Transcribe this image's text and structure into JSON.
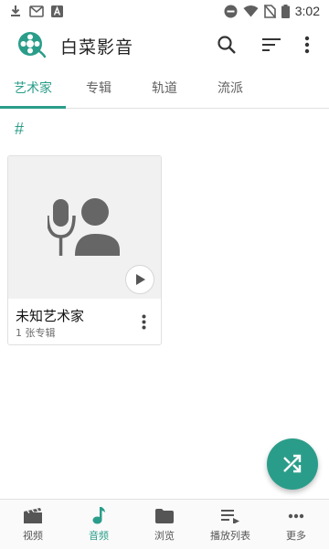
{
  "status_bar": {
    "time": "3:02",
    "left_icons": [
      "download-icon",
      "mail-icon",
      "font-icon"
    ],
    "right_icons": [
      "do-not-disturb-icon",
      "wifi-icon",
      "no-sim-icon",
      "battery-icon"
    ]
  },
  "app_bar": {
    "title": "白菜影音",
    "actions": [
      "search-icon",
      "sort-icon",
      "more-vert-icon"
    ]
  },
  "tabs": [
    {
      "label": "艺术家",
      "active": true
    },
    {
      "label": "专辑",
      "active": false
    },
    {
      "label": "轨道",
      "active": false
    },
    {
      "label": "流派",
      "active": false
    }
  ],
  "section": {
    "header": "#"
  },
  "artists": [
    {
      "name": "未知艺术家",
      "subtitle": "1 张专辑"
    }
  ],
  "fab": {
    "icon": "shuffle-icon"
  },
  "bottom_nav": [
    {
      "label": "视频",
      "icon": "video-icon",
      "active": false
    },
    {
      "label": "音频",
      "icon": "music-note-icon",
      "active": true
    },
    {
      "label": "浏览",
      "icon": "folder-icon",
      "active": false
    },
    {
      "label": "播放列表",
      "icon": "playlist-icon",
      "active": false
    },
    {
      "label": "更多",
      "icon": "more-horiz-icon",
      "active": false
    }
  ],
  "colors": {
    "accent": "#2a9d8a",
    "text_primary": "#212121",
    "text_secondary": "#616161",
    "card_art_bg": "#f1f1f1"
  }
}
